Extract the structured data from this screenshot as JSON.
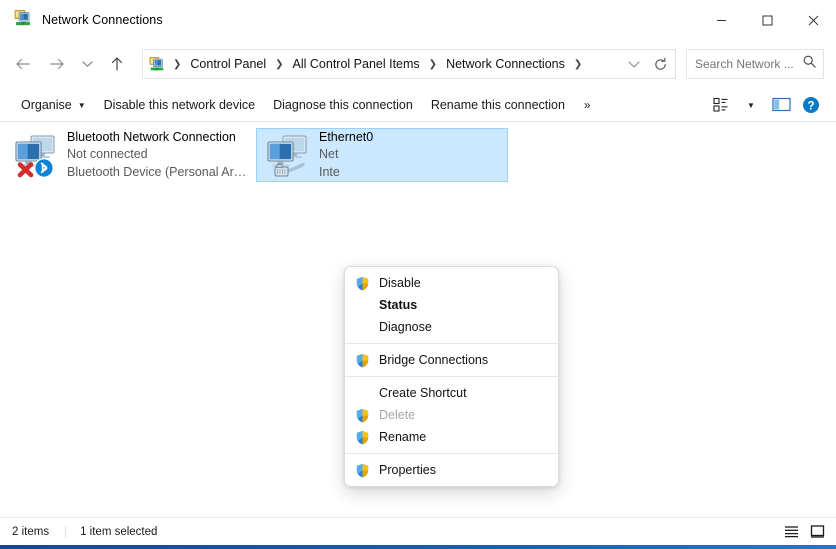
{
  "window": {
    "title": "Network Connections",
    "icon": "network-connections-icon",
    "minimize_label": "Minimise",
    "maximize_label": "Maximise",
    "close_label": "Close"
  },
  "nav": {
    "back_label": "Back",
    "forward_label": "Forward",
    "recent_label": "Recent locations",
    "up_label": "Up",
    "breadcrumbs": [
      {
        "label": "Control Panel"
      },
      {
        "label": "All Control Panel Items"
      },
      {
        "label": "Network Connections"
      }
    ],
    "dropdown_label": "Previous locations",
    "refresh_label": "Refresh"
  },
  "search": {
    "placeholder": "Search Network ...",
    "value": "",
    "icon": "search-icon"
  },
  "toolbar": {
    "organise_label": "Organise",
    "disable_label": "Disable this network device",
    "diagnose_label": "Diagnose this connection",
    "rename_label": "Rename this connection",
    "overflow_label": "»",
    "view_label": "Change your view",
    "preview_pane_label": "Show the preview pane",
    "help_label": "Help"
  },
  "connections": [
    {
      "name": "Bluetooth Network Connection",
      "status": "Not connected",
      "device": "Bluetooth Device (Personal Area ...",
      "selected": false,
      "icon": "bluetooth-network-adapter-icon",
      "badge": "disconnected-x-badge"
    },
    {
      "name": "Ethernet0",
      "status": "Net",
      "device": "Inte",
      "selected": true,
      "icon": "ethernet-network-adapter-icon",
      "badge": "none"
    }
  ],
  "context_menu": {
    "items": [
      {
        "label": "Disable",
        "shield": true,
        "bold": false,
        "disabled": false,
        "separator_after": false
      },
      {
        "label": "Status",
        "shield": false,
        "bold": true,
        "disabled": false,
        "separator_after": false
      },
      {
        "label": "Diagnose",
        "shield": false,
        "bold": false,
        "disabled": false,
        "separator_after": true
      },
      {
        "label": "Bridge Connections",
        "shield": true,
        "bold": false,
        "disabled": false,
        "separator_after": true
      },
      {
        "label": "Create Shortcut",
        "shield": false,
        "bold": false,
        "disabled": false,
        "separator_after": false
      },
      {
        "label": "Delete",
        "shield": true,
        "bold": false,
        "disabled": true,
        "separator_after": false
      },
      {
        "label": "Rename",
        "shield": true,
        "bold": false,
        "disabled": false,
        "separator_after": true
      },
      {
        "label": "Properties",
        "shield": true,
        "bold": false,
        "disabled": false,
        "separator_after": false
      }
    ]
  },
  "statusbar": {
    "item_count": "2 items",
    "selection": "1 item selected",
    "details_view_label": "Details view",
    "large_icons_view_label": "Large icons view"
  },
  "colors": {
    "selection_fill": "#cce8ff",
    "selection_border": "#99d1ff",
    "accent": "#1a5fae",
    "help_blue": "#0b7ac8",
    "link_text": "#1a1a1a",
    "disabled_text": "#a6a6a6"
  }
}
